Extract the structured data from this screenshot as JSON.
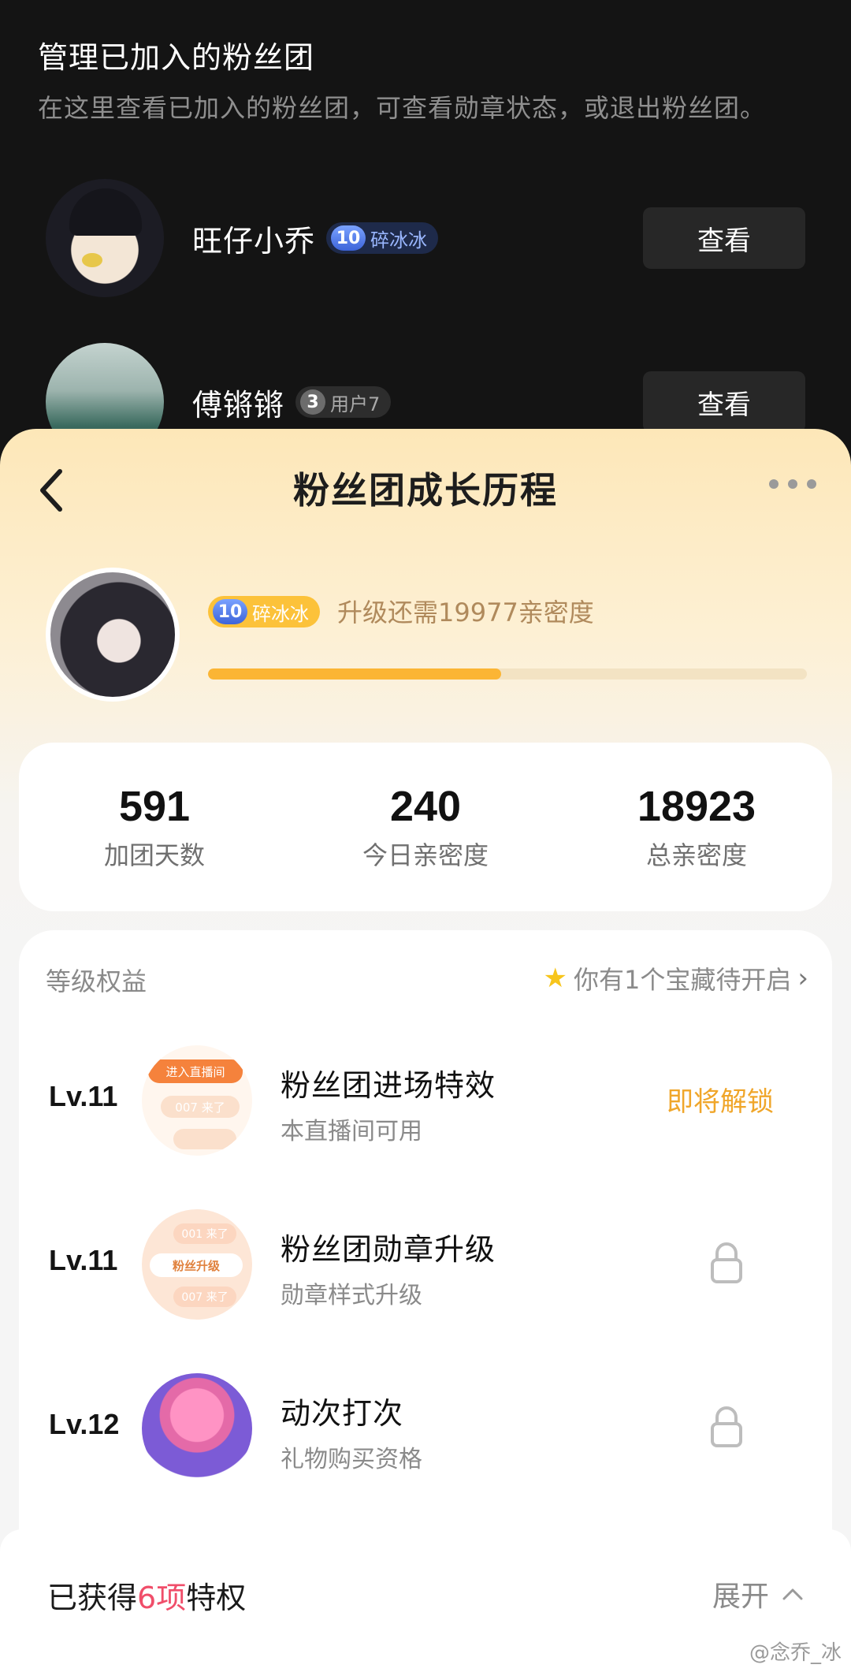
{
  "page": {
    "title": "管理已加入的粉丝团",
    "description": "在这里查看已加入的粉丝团，可查看勋章状态，或退出粉丝团。"
  },
  "clubs": [
    {
      "name": "旺仔小乔",
      "level": "10",
      "badge": "碎冰冰",
      "action": "查看",
      "badge_color": "#9ab7ff"
    },
    {
      "name": "傅锵锵",
      "level": "3",
      "badge": "用户7",
      "action": "查看",
      "badge_color": "#a9a9a9"
    }
  ],
  "sheet": {
    "title": "粉丝团成长历程",
    "badge_level": "10",
    "badge_name": "碎冰冰",
    "upgrade_text": "升级还需19977亲密度",
    "progress": 0.49,
    "stats": [
      {
        "value": "591",
        "label": "加团天数"
      },
      {
        "value": "240",
        "label": "今日亲密度"
      },
      {
        "value": "18923",
        "label": "总亲密度"
      }
    ],
    "perks_heading": "等级权益",
    "treasure_text": "你有1个宝藏待开启",
    "perks": [
      {
        "level": "Lv.11",
        "title": "粉丝团进场特效",
        "subtitle": "本直播间可用",
        "status": "即将解锁",
        "img_text_1": "进入直播间",
        "img_text_2": "007 来了"
      },
      {
        "level": "Lv.11",
        "title": "粉丝团勋章升级",
        "subtitle": "勋章样式升级",
        "status": "locked",
        "img_text_1": "001 来了",
        "img_text_2": "粉丝升级",
        "img_text_3": "007 来了"
      },
      {
        "level": "Lv.12",
        "title": "动次打次",
        "subtitle": "礼物购买资格",
        "status": "locked"
      }
    ],
    "footer": {
      "gained_prefix": "已获得",
      "gained_count": "6项",
      "gained_suffix": "特权",
      "expand_label": "展开"
    }
  },
  "watermark": "@念乔_冰",
  "colors": {
    "accent": "#fbb534",
    "highlight": "#f04e6a",
    "status": "#f0a62a"
  }
}
